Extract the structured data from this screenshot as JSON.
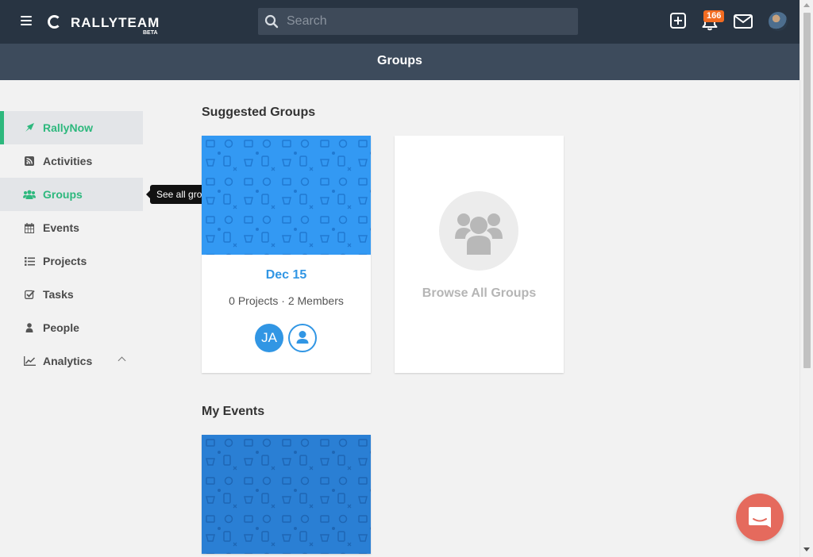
{
  "app": {
    "logo_text": "RALLYTEAM",
    "logo_badge": "BETA"
  },
  "search": {
    "placeholder": "Search",
    "value": ""
  },
  "header_icons": {
    "notification_count": "166"
  },
  "page": {
    "title": "Groups"
  },
  "sidebar": {
    "items": [
      {
        "label": "RallyNow",
        "icon": "rocket-icon"
      },
      {
        "label": "Activities",
        "icon": "rss-icon"
      },
      {
        "label": "Groups",
        "icon": "users-icon"
      },
      {
        "label": "Events",
        "icon": "calendar-icon"
      },
      {
        "label": "Projects",
        "icon": "list-icon"
      },
      {
        "label": "Tasks",
        "icon": "checkbox-icon"
      },
      {
        "label": "People",
        "icon": "person-icon"
      },
      {
        "label": "Analytics",
        "icon": "line-chart-icon"
      }
    ],
    "tooltip": "See all groups"
  },
  "suggested_groups": {
    "title": "Suggested Groups",
    "cards": [
      {
        "name": "Dec 15",
        "meta": "0 Projects · 2 Members",
        "member_initials": "JA"
      }
    ],
    "browse_label": "Browse All Groups"
  },
  "my_events": {
    "title": "My Events"
  },
  "colors": {
    "topbar": "#283442",
    "subheader": "#3d4b5c",
    "accent_green": "#2db87d",
    "accent_blue": "#3196e4",
    "badge_orange": "#f36c21",
    "intercom": "#e56a5d"
  }
}
